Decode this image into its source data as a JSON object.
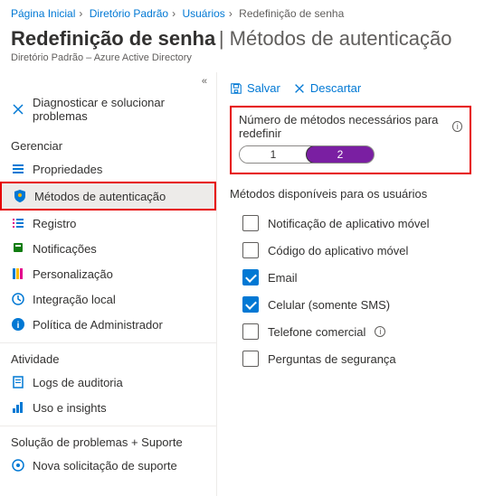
{
  "breadcrumb": {
    "items": [
      "Página Inicial",
      "Diretório Padrão",
      "Usuários"
    ],
    "current": "Redefinição de senha"
  },
  "header": {
    "title": "Redefinição de senha",
    "subtitle": "Métodos de autenticação",
    "tenant": "Diretório Padrão – Azure Active Directory"
  },
  "sidebar": {
    "diagnose": "Diagnosticar e solucionar problemas",
    "groups": {
      "manage": "Gerenciar",
      "activity": "Atividade",
      "support": "Solução de problemas + Suporte"
    },
    "manage_items": {
      "properties": "Propriedades",
      "auth_methods": "Métodos de autenticação",
      "registration": "Registro",
      "notifications": "Notificações",
      "customization": "Personalização",
      "onprem": "Integração local",
      "admin_policy": "Política de Administrador"
    },
    "activity_items": {
      "audit": "Logs de auditoria",
      "usage": "Uso e insights"
    },
    "support_items": {
      "new_request": "Nova solicitação de suporte"
    }
  },
  "toolbar": {
    "save": "Salvar",
    "discard": "Descartar"
  },
  "methods_required": {
    "label": "Número de métodos necessários para redefinir",
    "options": [
      "1",
      "2"
    ],
    "selected": "2"
  },
  "available_methods": {
    "label": "Métodos disponíveis para os usuários",
    "items": [
      {
        "label": "Notificação de aplicativo móvel",
        "checked": false,
        "info": false
      },
      {
        "label": "Código do aplicativo móvel",
        "checked": false,
        "info": false
      },
      {
        "label": "Email",
        "checked": true,
        "info": false
      },
      {
        "label": "Celular (somente SMS)",
        "checked": true,
        "info": false
      },
      {
        "label": "Telefone comercial",
        "checked": false,
        "info": true
      },
      {
        "label": "Perguntas de segurança",
        "checked": false,
        "info": false
      }
    ]
  }
}
